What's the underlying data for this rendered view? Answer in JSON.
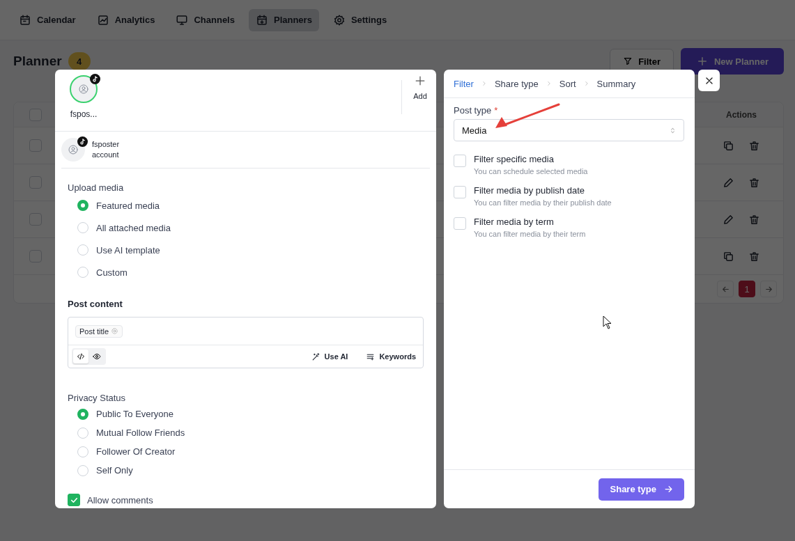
{
  "nav": {
    "tabs": [
      {
        "label": "Calendar",
        "kind": "calendar",
        "selected": false
      },
      {
        "label": "Analytics",
        "kind": "analytics",
        "selected": false
      },
      {
        "label": "Channels",
        "kind": "channels",
        "selected": false
      },
      {
        "label": "Planners",
        "kind": "planners",
        "selected": true
      },
      {
        "label": "Settings",
        "kind": "settings",
        "selected": false
      }
    ]
  },
  "page": {
    "title": "Planner",
    "count": "4",
    "filter_button": "Filter",
    "new_button": "New Planner"
  },
  "table": {
    "select_all_checked": false,
    "columns": [
      {
        "label": "Actions"
      }
    ],
    "rows": [
      {
        "checked": false,
        "actions": [
          {
            "kind": "duplicate"
          },
          {
            "kind": "delete"
          }
        ]
      },
      {
        "checked": false,
        "actions": [
          {
            "kind": "edit"
          },
          {
            "kind": "delete"
          }
        ]
      },
      {
        "checked": false,
        "actions": [
          {
            "kind": "edit"
          },
          {
            "kind": "delete"
          }
        ]
      },
      {
        "checked": false,
        "actions": [
          {
            "kind": "duplicate"
          },
          {
            "kind": "delete"
          }
        ]
      }
    ],
    "pagination": [
      {
        "kind": "prev"
      },
      {
        "kind": "page",
        "label": "1",
        "selected": true
      },
      {
        "kind": "next"
      }
    ]
  },
  "left_panel": {
    "channels": [
      {
        "name": "fspos...",
        "selected": true
      }
    ],
    "add_label": "Add",
    "account": {
      "name": "fsposter",
      "detail": "account"
    },
    "upload_media": {
      "label": "Upload media",
      "options": [
        {
          "label": "Featured media",
          "selected": true
        },
        {
          "label": "All attached media",
          "selected": false
        },
        {
          "label": "Use AI template",
          "selected": false
        },
        {
          "label": "Custom",
          "selected": false
        }
      ]
    },
    "post_content": {
      "label": "Post content",
      "tags": [
        {
          "label": "Post title"
        }
      ],
      "modes": [
        {
          "kind": "code",
          "selected": true
        },
        {
          "kind": "preview",
          "selected": false
        }
      ],
      "tools": [
        {
          "kind": "ai",
          "label": "Use AI"
        },
        {
          "kind": "keywords",
          "label": "Keywords"
        }
      ]
    },
    "privacy_status": {
      "label": "Privacy Status",
      "options": [
        {
          "label": "Public To Everyone",
          "selected": true
        },
        {
          "label": "Mutual Follow Friends",
          "selected": false
        },
        {
          "label": "Follower Of Creator",
          "selected": false
        },
        {
          "label": "Self Only",
          "selected": false
        }
      ]
    },
    "allow_comments": {
      "label": "Allow comments",
      "checked": true
    }
  },
  "right_panel": {
    "steps": [
      {
        "label": "Filter",
        "selected": true
      },
      {
        "label": "Share type",
        "selected": false
      },
      {
        "label": "Sort",
        "selected": false
      },
      {
        "label": "Summary",
        "selected": false
      }
    ],
    "post_type": {
      "label": "Post type",
      "required_mark": "*",
      "value": "Media"
    },
    "filters": [
      {
        "label": "Filter specific media",
        "hint": "You can schedule selected media",
        "checked": false
      },
      {
        "label": "Filter media by publish date",
        "hint": "You can filter media by their publish date",
        "checked": false
      },
      {
        "label": "Filter media by term",
        "hint": "You can filter media by their term",
        "checked": false
      }
    ],
    "next_button": "Share type"
  }
}
